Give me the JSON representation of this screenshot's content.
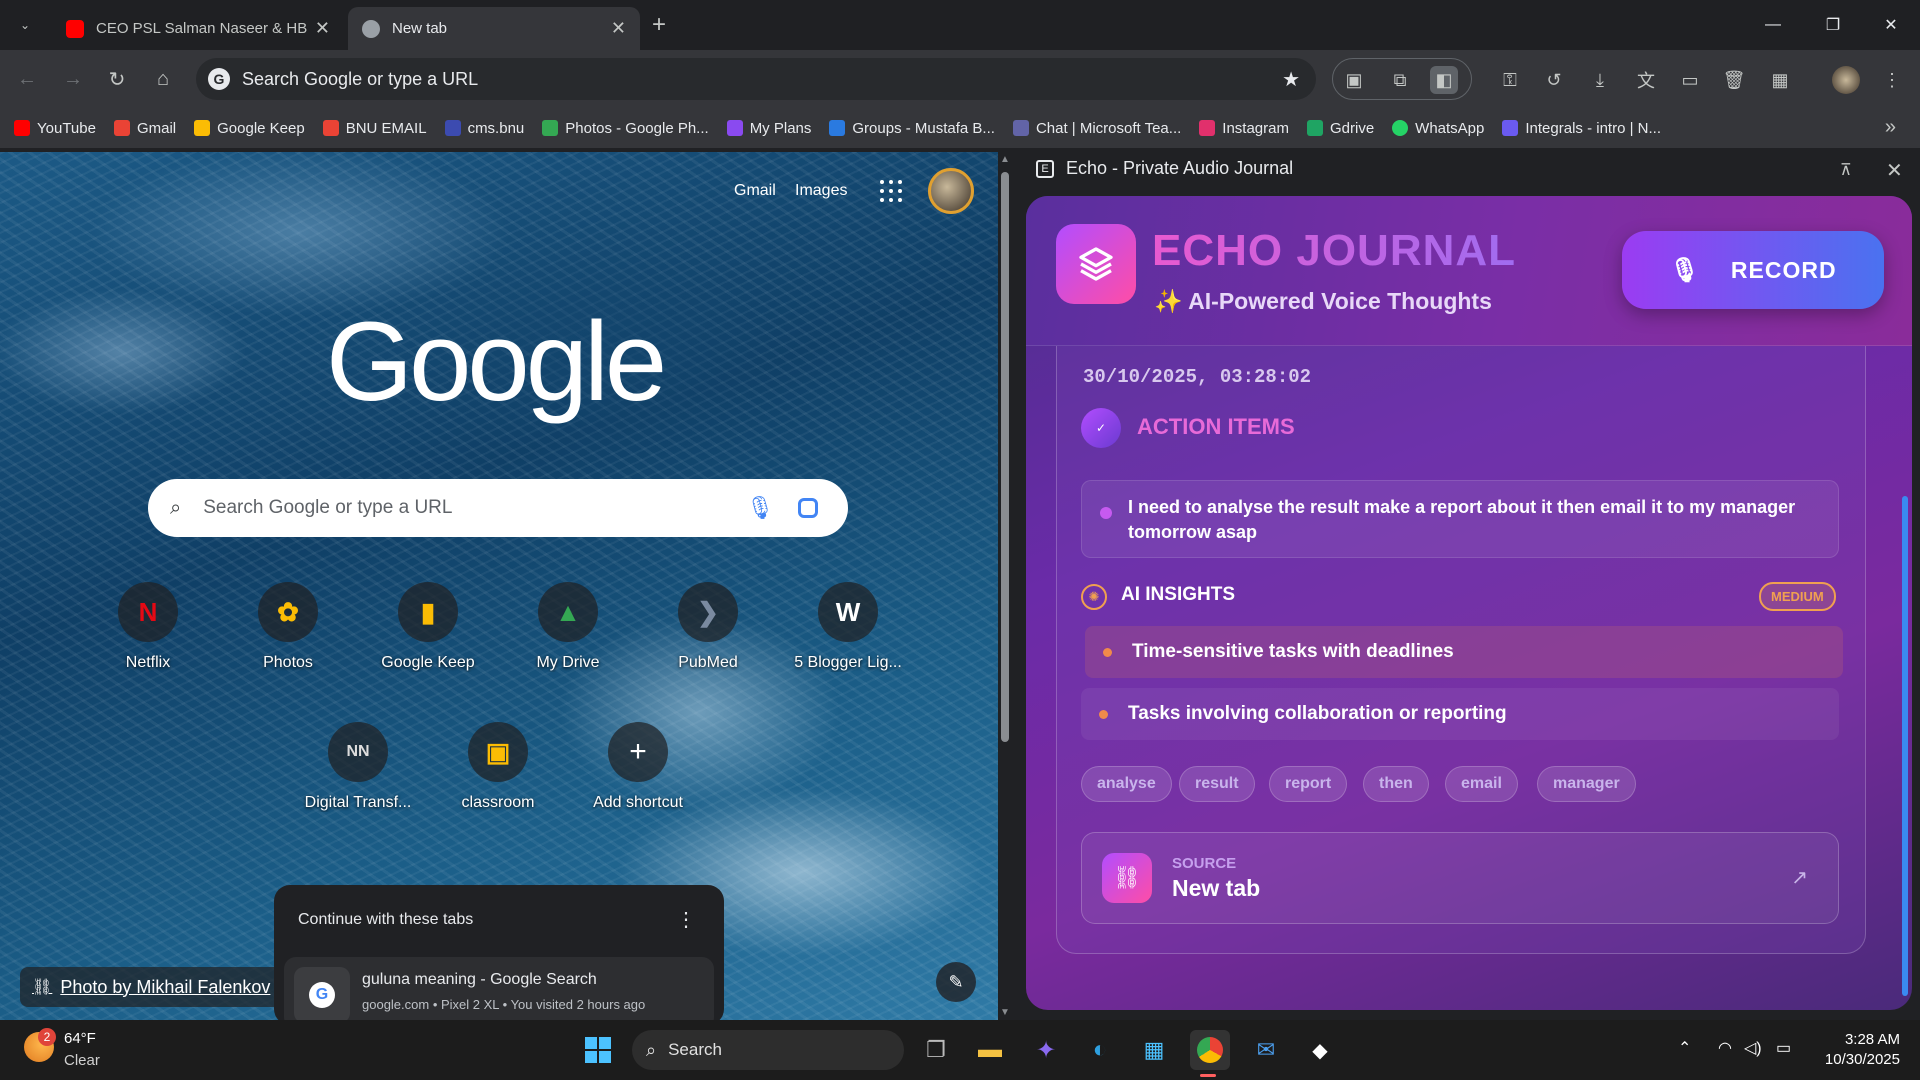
{
  "tabs": [
    {
      "title": "CEO PSL Salman Naseer & HBL",
      "favicon_color": "#ff0000"
    },
    {
      "title": "New tab",
      "favicon_color": "#9aa0a6"
    }
  ],
  "omnibox": {
    "placeholder": "Search Google or type a URL"
  },
  "bookmarks": [
    {
      "label": "YouTube",
      "color": "#ff0000"
    },
    {
      "label": "Gmail",
      "color": "#ea4335"
    },
    {
      "label": "Google Keep",
      "color": "#fbbc04"
    },
    {
      "label": "BNU EMAIL",
      "color": "#ea4335"
    },
    {
      "label": "cms.bnu",
      "color": "#3c4bb0"
    },
    {
      "label": "Photos - Google Ph...",
      "color": "#34a853"
    },
    {
      "label": "My Plans",
      "color": "#8a4af0"
    },
    {
      "label": "Groups - Mustafa B...",
      "color": "#2a7ae0"
    },
    {
      "label": "Chat | Microsoft Tea...",
      "color": "#6264a7"
    },
    {
      "label": "Instagram",
      "color": "#e1306c"
    },
    {
      "label": "Gdrive",
      "color": "#1fa463"
    },
    {
      "label": "WhatsApp",
      "color": "#25d366"
    },
    {
      "label": "Integrals - intro | N...",
      "color": "#6a5af0"
    }
  ],
  "ntp": {
    "gmail": "Gmail",
    "images": "Images",
    "logo": "Google",
    "search_placeholder": "Search Google or type a URL",
    "shortcuts": [
      {
        "label": "Netflix",
        "glyph": "N",
        "color": "#e50914"
      },
      {
        "label": "Photos",
        "glyph": "✿",
        "color": "#fbbc04"
      },
      {
        "label": "Google Keep",
        "glyph": "▮",
        "color": "#fbbc04"
      },
      {
        "label": "My Drive",
        "glyph": "▲",
        "color": "#34a853"
      },
      {
        "label": "PubMed",
        "glyph": "❯",
        "color": "#5a6a80"
      },
      {
        "label": "5 Blogger Lig...",
        "glyph": "W",
        "color": "#ffffff"
      },
      {
        "label": "Digital Transf...",
        "glyph": "NN",
        "color": "#dddddd"
      },
      {
        "label": "classroom",
        "glyph": "▣",
        "color": "#fbbc04"
      },
      {
        "label": "Add shortcut",
        "glyph": "+",
        "color": "#ffffff"
      }
    ],
    "photo_credit": "Photo by Mikhail Falenkov",
    "continue": {
      "header": "Continue with these tabs",
      "item_title": "guluna meaning - Google Search",
      "item_sub": "google.com • Pixel 2 XL • You visited 2 hours ago"
    }
  },
  "side_panel": {
    "title": "Echo - Private Audio Journal",
    "app_title": "ECHO JOURNAL",
    "subtitle": "✨ AI-Powered Voice Thoughts",
    "record_label": "RECORD",
    "timestamp": "30/10/2025, 03:28:02",
    "action_items_title": "ACTION ITEMS",
    "action_item": "I need to analyse the result make a report about it then email it to my manager tomorrow asap",
    "insights_title": "AI INSIGHTS",
    "insights_badge": "MEDIUM",
    "insights": [
      "Time-sensitive tasks with deadlines",
      "Tasks involving collaboration or reporting"
    ],
    "tags": [
      "analyse",
      "result",
      "report",
      "then",
      "email",
      "manager"
    ],
    "source_label": "SOURCE",
    "source_value": "New tab"
  },
  "taskbar": {
    "weather_temp": "64°F",
    "weather_cond": "Clear",
    "weather_badge": "2",
    "search_label": "Search",
    "time": "3:28 AM",
    "date": "10/30/2025"
  }
}
